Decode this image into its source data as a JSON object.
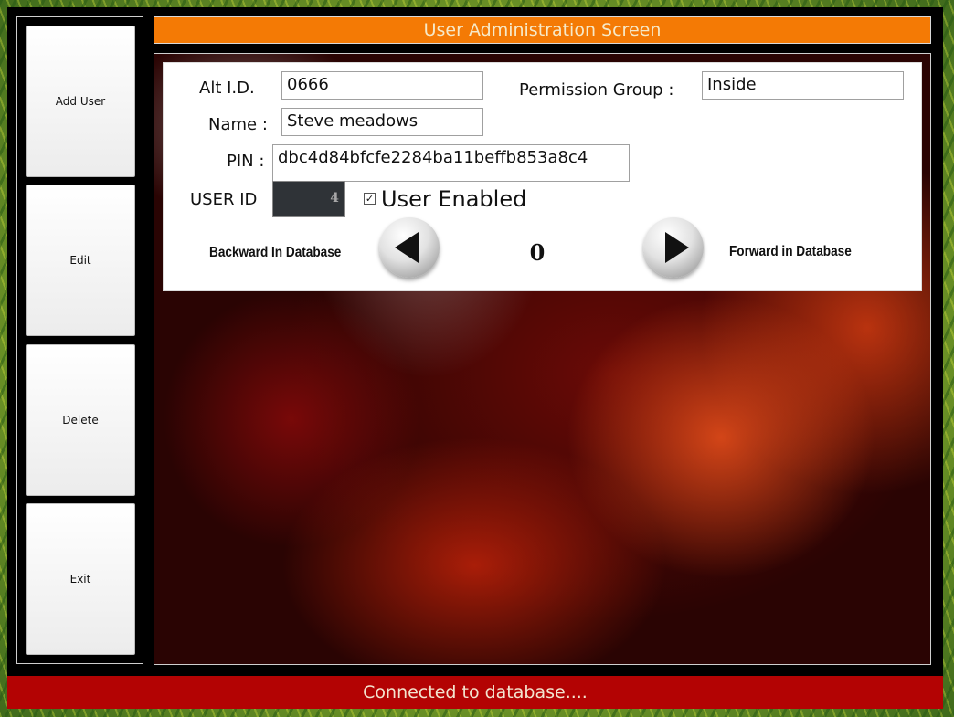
{
  "title": "User Administration Screen",
  "sidebar": {
    "add_user": "Add User",
    "edit": "Edit",
    "delete": "Delete",
    "exit": "Exit"
  },
  "form": {
    "alt_id_label": "Alt I.D.",
    "alt_id_value": "0666",
    "permission_group_label": "Permission Group :",
    "permission_group_value": "Inside",
    "name_label": "Name :",
    "name_value": "Steve meadows",
    "pin_label": "PIN :",
    "pin_value": "dbc4d84bfcfe2284ba11beffb853a8c4",
    "user_id_label": "USER ID",
    "user_id_value": "4",
    "user_enabled_label": "User Enabled",
    "user_enabled_checked": true
  },
  "navigation": {
    "backward_label": "Backward In Database",
    "forward_label": "Forward in Database",
    "record_index": "0",
    "backward_icon": "left-arrow-icon",
    "forward_icon": "right-arrow-icon"
  },
  "status": "Connected to database....",
  "colors": {
    "title_bar": "#f47a05",
    "status_bar": "#b30303"
  }
}
